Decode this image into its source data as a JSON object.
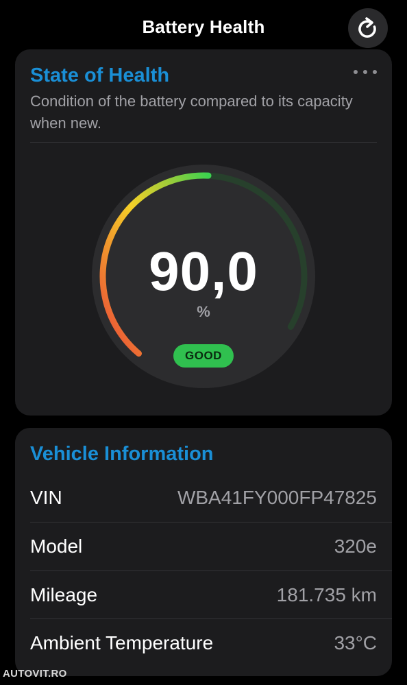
{
  "header": {
    "title": "Battery Health",
    "refresh_icon": "refresh-icon"
  },
  "soh_card": {
    "title": "State of Health",
    "subtitle": "Condition of the battery compared to its capacity when new.",
    "more_icon": "more-icon",
    "gauge": {
      "value_text": "90,0",
      "value": 90.0,
      "unit": "%",
      "status": "GOOD",
      "status_color": "#30c04f",
      "arc_colors": [
        "#e8423a",
        "#f0902e",
        "#f5d028",
        "#9ccc3a",
        "#3cd24f"
      ],
      "track_color": "#27402c"
    }
  },
  "vehicle_card": {
    "title": "Vehicle Information",
    "rows": [
      {
        "label": "VIN",
        "value": "WBA41FY000FP47825"
      },
      {
        "label": "Model",
        "value": "320e"
      },
      {
        "label": "Mileage",
        "value": "181.735 km"
      },
      {
        "label": "Ambient Temperature",
        "value": "33°C"
      }
    ]
  },
  "watermark": "AUTOVIT.RO",
  "colors": {
    "accent": "#1a8fd6",
    "card_bg": "#1c1c1e",
    "secondary_text": "#a1a1a6"
  }
}
